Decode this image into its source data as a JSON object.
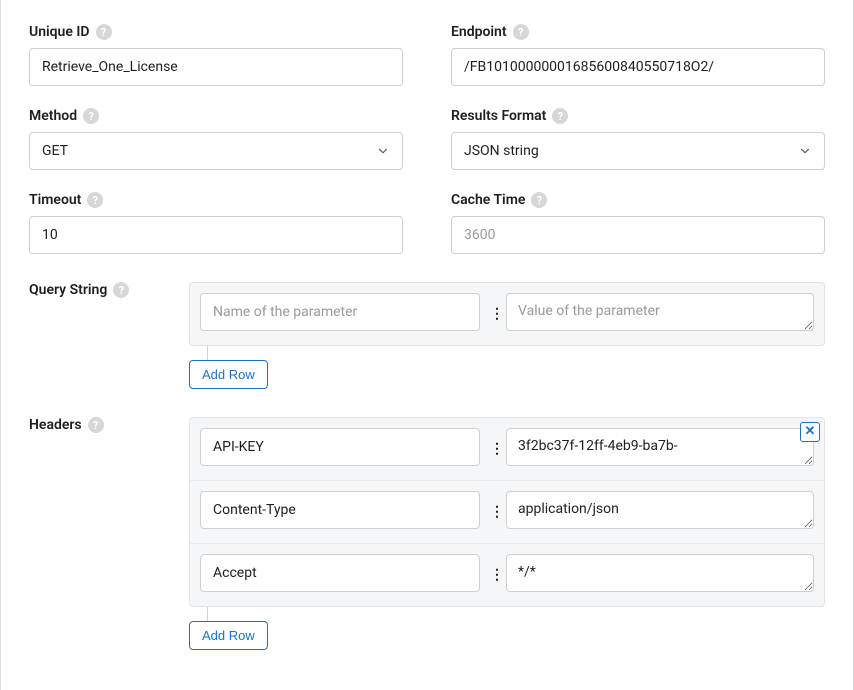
{
  "top": {
    "uniqueId": {
      "label": "Unique ID",
      "value": "Retrieve_One_License"
    },
    "endpoint": {
      "label": "Endpoint",
      "value": "/FB10100000001685600840550718O2/"
    },
    "method": {
      "label": "Method",
      "value": "GET"
    },
    "results": {
      "label": "Results Format",
      "value": "JSON string"
    },
    "timeout": {
      "label": "Timeout",
      "value": "10"
    },
    "cache": {
      "label": "Cache Time",
      "placeholder": "3600"
    }
  },
  "queryString": {
    "label": "Query String",
    "namePlaceholder": "Name of the parameter",
    "valuePlaceholder": "Value of the parameter",
    "addRow": "Add Row"
  },
  "headers": {
    "label": "Headers",
    "rows": [
      {
        "name": "API-KEY",
        "value": "3f2bc37f-12ff-4eb9-ba7b-"
      },
      {
        "name": "Content-Type",
        "value": "application/json"
      },
      {
        "name": "Accept",
        "value": "*/*"
      }
    ],
    "addRow": "Add Row"
  }
}
